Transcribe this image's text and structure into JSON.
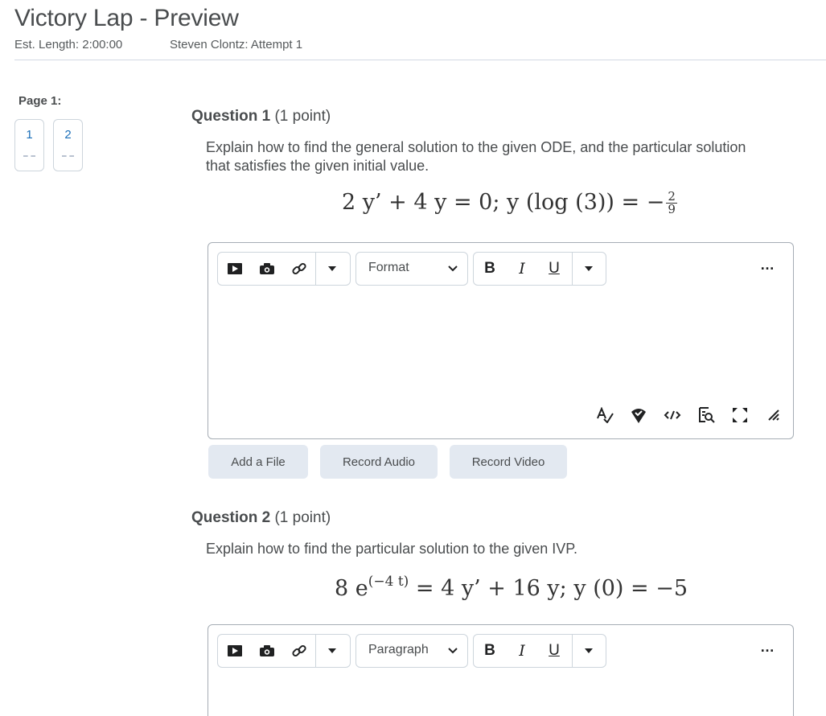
{
  "header": {
    "title": "Victory Lap - Preview",
    "est_length": "Est. Length: 2:00:00",
    "attempt": "Steven Clontz: Attempt 1"
  },
  "sidebar": {
    "page_label": "Page 1:",
    "pages": [
      {
        "label": "1"
      },
      {
        "label": "2"
      }
    ]
  },
  "questions": [
    {
      "title": "Question 1",
      "points": "(1 point)",
      "text": "Explain how to find the general solution to the given ODE, and the particular solution that satisfies the given initial value.",
      "math_lhs": "2 y’ + 4 y = 0; y (log (3)) = −",
      "math_frac_num": "2",
      "math_frac_den": "9",
      "editor": {
        "format_label": "Format",
        "bold": "B",
        "italic": "I",
        "underline": "U",
        "more": "…"
      },
      "actions": {
        "add_file": "Add a File",
        "record_audio": "Record Audio",
        "record_video": "Record Video"
      }
    },
    {
      "title": "Question 2",
      "points": "(1 point)",
      "text": "Explain how to find the particular solution to the given IVP.",
      "math_base": "8 e",
      "math_exp": "(−4 t)",
      "math_rest": " = 4 y’ + 16 y; y (0) = −5",
      "editor": {
        "format_label": "Paragraph",
        "bold": "B",
        "italic": "I",
        "underline": "U",
        "more": "…"
      }
    }
  ]
}
